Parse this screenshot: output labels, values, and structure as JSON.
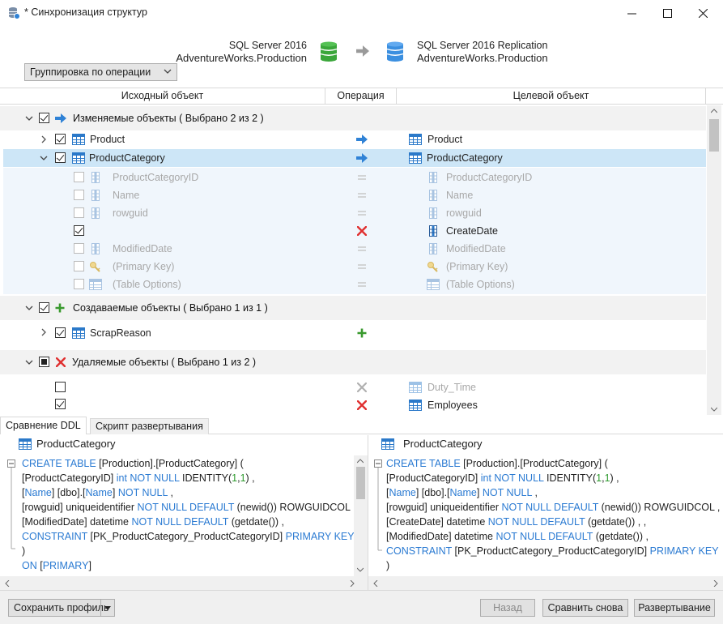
{
  "window": {
    "title": "* Синхронизация структур"
  },
  "source": {
    "server": "SQL Server 2016",
    "database": "AdventureWorks.Production"
  },
  "target": {
    "server": "SQL Server 2016 Replication",
    "database": "AdventureWorks.Production"
  },
  "grouping_button": "Группировка по операции",
  "columns": {
    "source": "Исходный объект",
    "operation": "Операция",
    "target": "Целевой объект"
  },
  "groups": {
    "modified": "Изменяемые объекты ( Выбрано 2 из 2 )",
    "created": "Создаваемые объекты ( Выбрано 1 из 1 )",
    "deleted": "Удаляемые объекты ( Выбрано 1 из 2 )"
  },
  "rows": {
    "product_src": "Product",
    "product_dst": "Product",
    "pc_src": "ProductCategory",
    "pc_dst": "ProductCategory",
    "c1_src": "ProductCategoryID",
    "c1_dst": "ProductCategoryID",
    "c2_src": "Name",
    "c2_dst": "Name",
    "c3_src": "rowguid",
    "c3_dst": "rowguid",
    "c4_dst": "CreateDate",
    "c5_src": "ModifiedDate",
    "c5_dst": "ModifiedDate",
    "c6_src": "(Primary Key)",
    "c6_dst": "(Primary Key)",
    "c7_src": "(Table Options)",
    "c7_dst": "(Table Options)",
    "scrap_src": "ScrapReason",
    "del1_dst": "Duty_Time",
    "del2_dst": "Employees"
  },
  "tabs": {
    "ddl": "Сравнение DDL",
    "script": "Скрипт развертывания"
  },
  "left_pane": {
    "title": "ProductCategory",
    "lines": [
      [
        [
          "kw",
          "CREATE TABLE"
        ],
        [
          "t",
          " [Production].[ProductCategory] ("
        ]
      ],
      [
        [
          "t",
          "[ProductCategoryID] "
        ],
        [
          "kw",
          "int NOT NULL"
        ],
        [
          "t",
          " IDENTITY("
        ],
        [
          "num",
          "1"
        ],
        [
          "t",
          ","
        ],
        [
          "num",
          "1"
        ],
        [
          "t",
          ") ,"
        ]
      ],
      [
        [
          "t",
          "["
        ],
        [
          "kw",
          "Name"
        ],
        [
          "t",
          "] [dbo].["
        ],
        [
          "kw",
          "Name"
        ],
        [
          "t",
          "] "
        ],
        [
          "kw",
          "NOT NULL"
        ],
        [
          "t",
          " ,"
        ]
      ],
      [
        [
          "t",
          "[rowguid] uniqueidentifier "
        ],
        [
          "kw",
          "NOT NULL DEFAULT"
        ],
        [
          "t",
          " (newid()) ROWGUIDCOL ,"
        ]
      ],
      [
        [
          "t",
          "[ModifiedDate] datetime "
        ],
        [
          "kw",
          "NOT NULL DEFAULT"
        ],
        [
          "t",
          " (getdate()) ,"
        ]
      ],
      [
        [
          "kw",
          "CONSTRAINT"
        ],
        [
          "t",
          " [PK_ProductCategory_ProductCategoryID] "
        ],
        [
          "kw",
          "PRIMARY KEY"
        ],
        [
          "t",
          " ("
        ]
      ],
      [
        [
          "t",
          ")"
        ]
      ],
      [
        [
          "kw",
          "ON"
        ],
        [
          "t",
          " ["
        ],
        [
          "kw",
          "PRIMARY"
        ],
        [
          "t",
          "]"
        ]
      ]
    ]
  },
  "right_pane": {
    "title": "ProductCategory",
    "lines": [
      [
        [
          "kw",
          "CREATE TABLE"
        ],
        [
          "t",
          " [Production].[ProductCategory] ("
        ]
      ],
      [
        [
          "t",
          "[ProductCategoryID] "
        ],
        [
          "kw",
          "int NOT NULL"
        ],
        [
          "t",
          " IDENTITY("
        ],
        [
          "num",
          "1"
        ],
        [
          "t",
          ","
        ],
        [
          "num",
          "1"
        ],
        [
          "t",
          ") ,"
        ]
      ],
      [
        [
          "t",
          "["
        ],
        [
          "kw",
          "Name"
        ],
        [
          "t",
          "] [dbo].["
        ],
        [
          "kw",
          "Name"
        ],
        [
          "t",
          "] "
        ],
        [
          "kw",
          "NOT NULL"
        ],
        [
          "t",
          " ,"
        ]
      ],
      [
        [
          "t",
          "[rowguid] uniqueidentifier "
        ],
        [
          "kw",
          "NOT NULL DEFAULT"
        ],
        [
          "t",
          " (newid()) ROWGUIDCOL ,"
        ]
      ],
      [
        [
          "t",
          "[CreateDate] datetime "
        ],
        [
          "kw",
          "NOT NULL DEFAULT"
        ],
        [
          "t",
          " (getdate()) , ,"
        ]
      ],
      [
        [
          "t",
          "[ModifiedDate] datetime "
        ],
        [
          "kw",
          "NOT NULL DEFAULT"
        ],
        [
          "t",
          " (getdate()) ,"
        ]
      ],
      [
        [
          "kw",
          "CONSTRAINT"
        ],
        [
          "t",
          " [PK_ProductCategory_ProductCategoryID] "
        ],
        [
          "kw",
          "PRIMARY KEY"
        ],
        [
          "t",
          " ("
        ]
      ],
      [
        [
          "t",
          ")"
        ]
      ]
    ]
  },
  "footer": {
    "save_profile": "Сохранить профиль",
    "back": "Назад",
    "compare_again": "Сравнить снова",
    "deploy": "Развертывание"
  },
  "colors": {
    "accent_blue": "#2a7ad2",
    "selection": "#cde6f7",
    "delete_red": "#e03030",
    "create_green": "#3a9a2e",
    "db_green": "#3aa63a",
    "db_blue": "#3b8fe0"
  }
}
